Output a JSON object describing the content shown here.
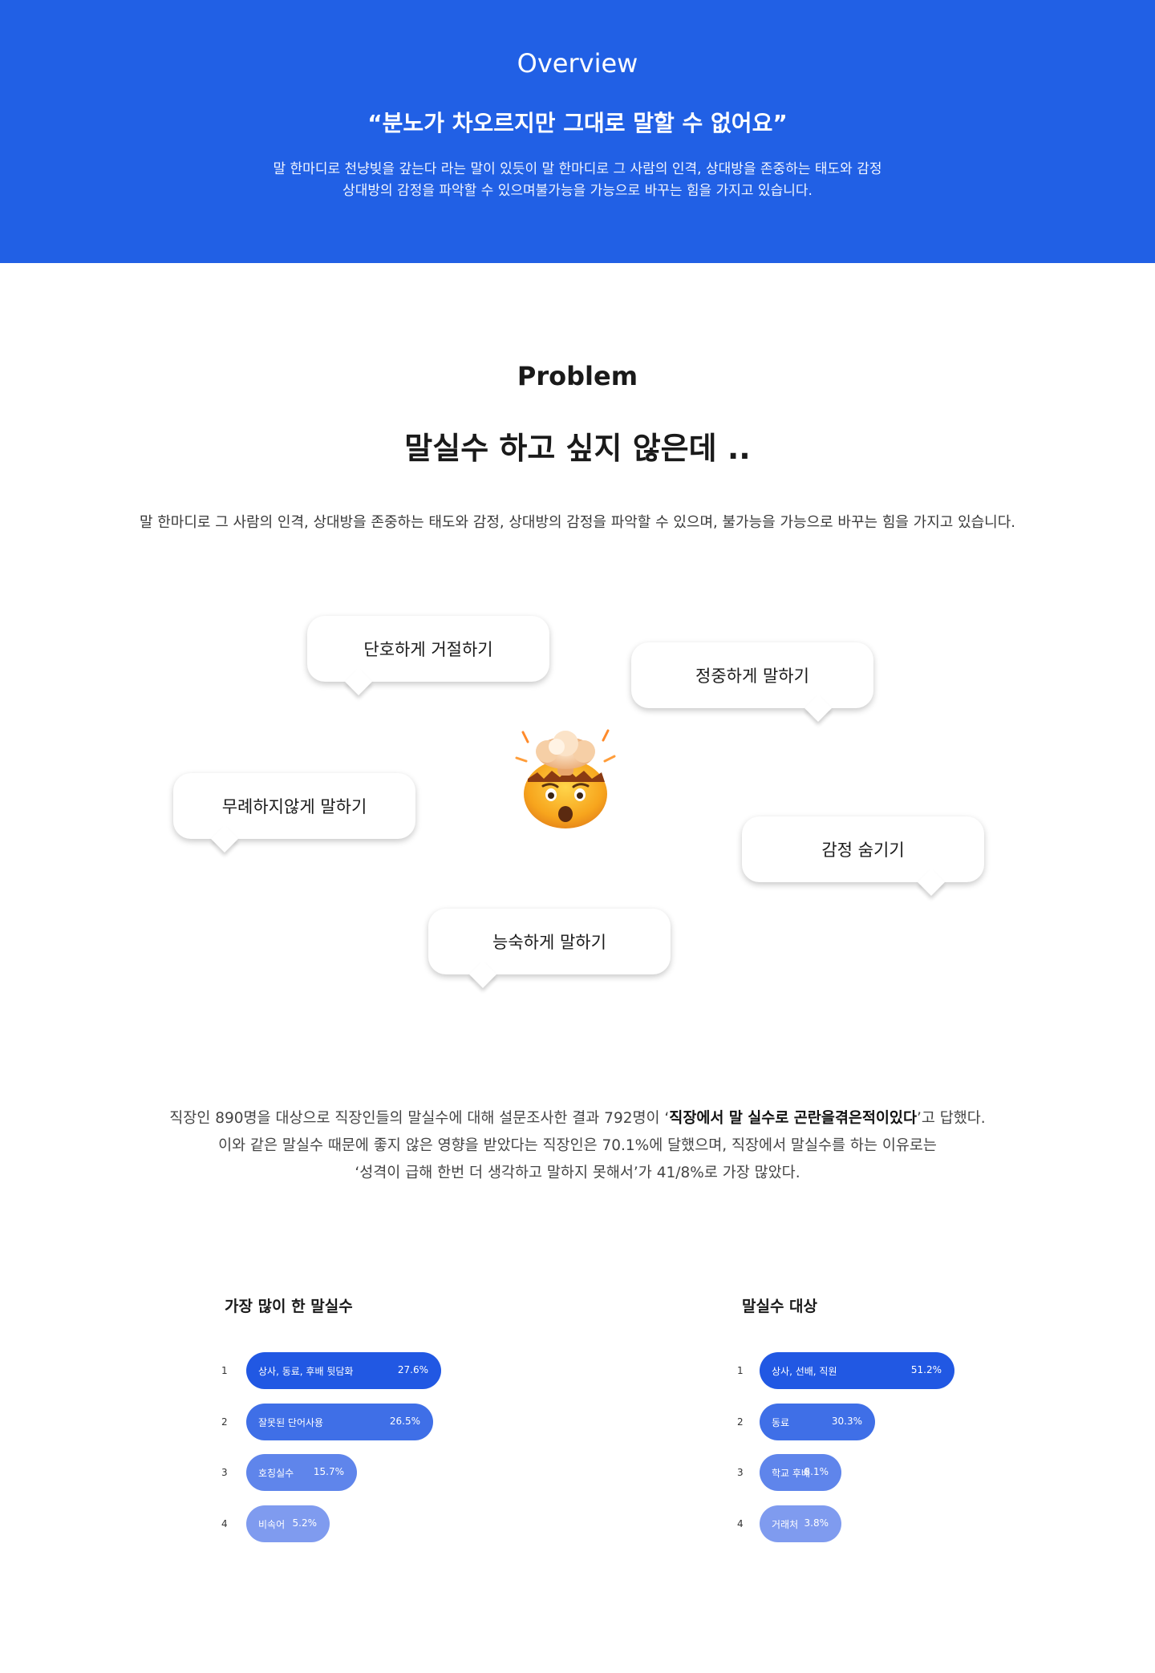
{
  "overview": {
    "title": "Overview",
    "quote": "“분노가 차오르지만 그대로 말할 수 없어요”",
    "desc_line1": "말 한마디로 천냥빚을 갚는다 라는 말이 있듯이 말 한마디로 그 사람의 인격, 상대방을 존중하는 태도와 감정",
    "desc_line2": "상대방의 감정을 파악할 수 있으며불가능을 가능으로 바꾸는 힘을 가지고 있습니다."
  },
  "problem": {
    "title": "Problem",
    "headline": "말실수 하고 싶지 않은데 ..",
    "desc": "말 한마디로 그 사람의 인격, 상대방을 존중하는 태도와 감정, 상대방의 감정을 파악할 수 있으며, 불가능을 가능으로 바꾸는 힘을 가지고 있습니다.",
    "emoji": "🤯",
    "emoji_icon": "exploding-head-icon",
    "bubbles": [
      {
        "text": "단호하게 거절하기"
      },
      {
        "text": "정중하게 말하기"
      },
      {
        "text": "무례하지않게 말하기"
      },
      {
        "text": "감정 숨기기"
      },
      {
        "text": "능숙하게 말하기"
      }
    ]
  },
  "survey": {
    "line1_pre": "직장인 890명을 대상으로 직장인들의 말실수에 대해 설문조사한 결과 792명이 ‘",
    "line1_bold": "직장에서 말 실수로 곤란을겪은적이있다",
    "line1_post": "’고 답했다.",
    "line2": "이와 같은 말실수 때문에 좋지 않은 영향을 받았다는 직장인은 70.1%에 달했으며, 직장에서 말실수를 하는 이유로는",
    "line3": "‘성격이 급해  한번 더 생각하고 말하지 못해서’가 41/8%로 가장 많았다."
  },
  "colors": {
    "brand_blue": "#2160e5",
    "rank1": "#2158e3",
    "rank2": "#3f6fe7",
    "rank3": "#5f85eb",
    "rank4": "#7f9bef"
  },
  "chart_data": [
    {
      "type": "bar",
      "title": "가장 많이 한 말실수",
      "ranks": [
        "1",
        "2",
        "3",
        "4"
      ],
      "categories": [
        "상사, 동료, 후배 뒷담화",
        "잘못된 단어사용",
        "호칭실수",
        "비속어"
      ],
      "values": [
        27.6,
        26.5,
        15.7,
        5.2
      ],
      "value_labels": [
        "27.6%",
        "26.5%",
        "15.7%",
        "5.2%"
      ]
    },
    {
      "type": "bar",
      "title": "말실수 대상",
      "ranks": [
        "1",
        "2",
        "3",
        "4"
      ],
      "categories": [
        "상사, 선배, 직원",
        "동료",
        "학교 후배",
        "거래처"
      ],
      "values": [
        51.2,
        30.3,
        8.1,
        3.8
      ],
      "value_labels": [
        "51.2%",
        "30.3%",
        "8.1%",
        "3.8%"
      ]
    }
  ]
}
